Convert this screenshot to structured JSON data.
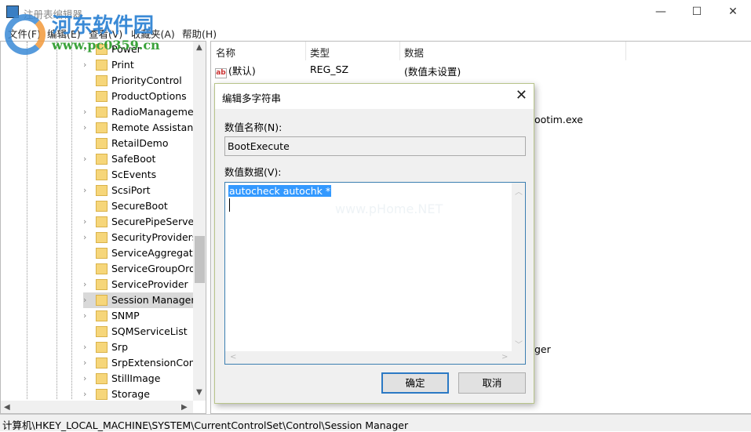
{
  "window": {
    "title": "注册表编辑器",
    "minimize": "—",
    "maximize": "☐",
    "close": "✕"
  },
  "menu": [
    "文件(F)",
    "编辑(E)",
    "查看(V)",
    "收藏夹(A)",
    "帮助(H)"
  ],
  "watermark": {
    "name": "河东软件园",
    "url": "www.pc0359.cn"
  },
  "tree": {
    "items": [
      {
        "label": "Power",
        "expandable": true
      },
      {
        "label": "Print",
        "expandable": true
      },
      {
        "label": "PriorityControl",
        "expandable": false
      },
      {
        "label": "ProductOptions",
        "expandable": false
      },
      {
        "label": "RadioManagement",
        "expandable": true
      },
      {
        "label": "Remote Assistance",
        "expandable": true
      },
      {
        "label": "RetailDemo",
        "expandable": false
      },
      {
        "label": "SafeBoot",
        "expandable": true
      },
      {
        "label": "ScEvents",
        "expandable": false
      },
      {
        "label": "ScsiPort",
        "expandable": true
      },
      {
        "label": "SecureBoot",
        "expandable": false
      },
      {
        "label": "SecurePipeServers",
        "expandable": true
      },
      {
        "label": "SecurityProviders",
        "expandable": true
      },
      {
        "label": "ServiceAggregatedEvents",
        "expandable": false
      },
      {
        "label": "ServiceGroupOrder",
        "expandable": false
      },
      {
        "label": "ServiceProvider",
        "expandable": true
      },
      {
        "label": "Session Manager",
        "expandable": true,
        "selected": true
      },
      {
        "label": "SNMP",
        "expandable": true
      },
      {
        "label": "SQMServiceList",
        "expandable": false
      },
      {
        "label": "Srp",
        "expandable": true
      },
      {
        "label": "SrpExtensionConfig",
        "expandable": true
      },
      {
        "label": "StillImage",
        "expandable": true
      },
      {
        "label": "Storage",
        "expandable": true
      }
    ]
  },
  "list": {
    "columns": [
      "名称",
      "类型",
      "数据"
    ],
    "rows": [
      {
        "name": "(默认)",
        "type": "REG_SZ",
        "data": "(数值未设置)",
        "icon": "string-value-icon"
      }
    ],
    "fragments": [
      "ootim.exe",
      "ger"
    ]
  },
  "status": "计算机\\HKEY_LOCAL_MACHINE\\SYSTEM\\CurrentControlSet\\Control\\Session Manager",
  "dialog": {
    "title": "编辑多字符串",
    "close": "✕",
    "name_label": "数值名称(N):",
    "name_value": "BootExecute",
    "data_label": "数值数据(V):",
    "data_value": "autocheck autochk *",
    "ok": "确定",
    "cancel": "取消",
    "watermark": "www.pHome.NET"
  }
}
